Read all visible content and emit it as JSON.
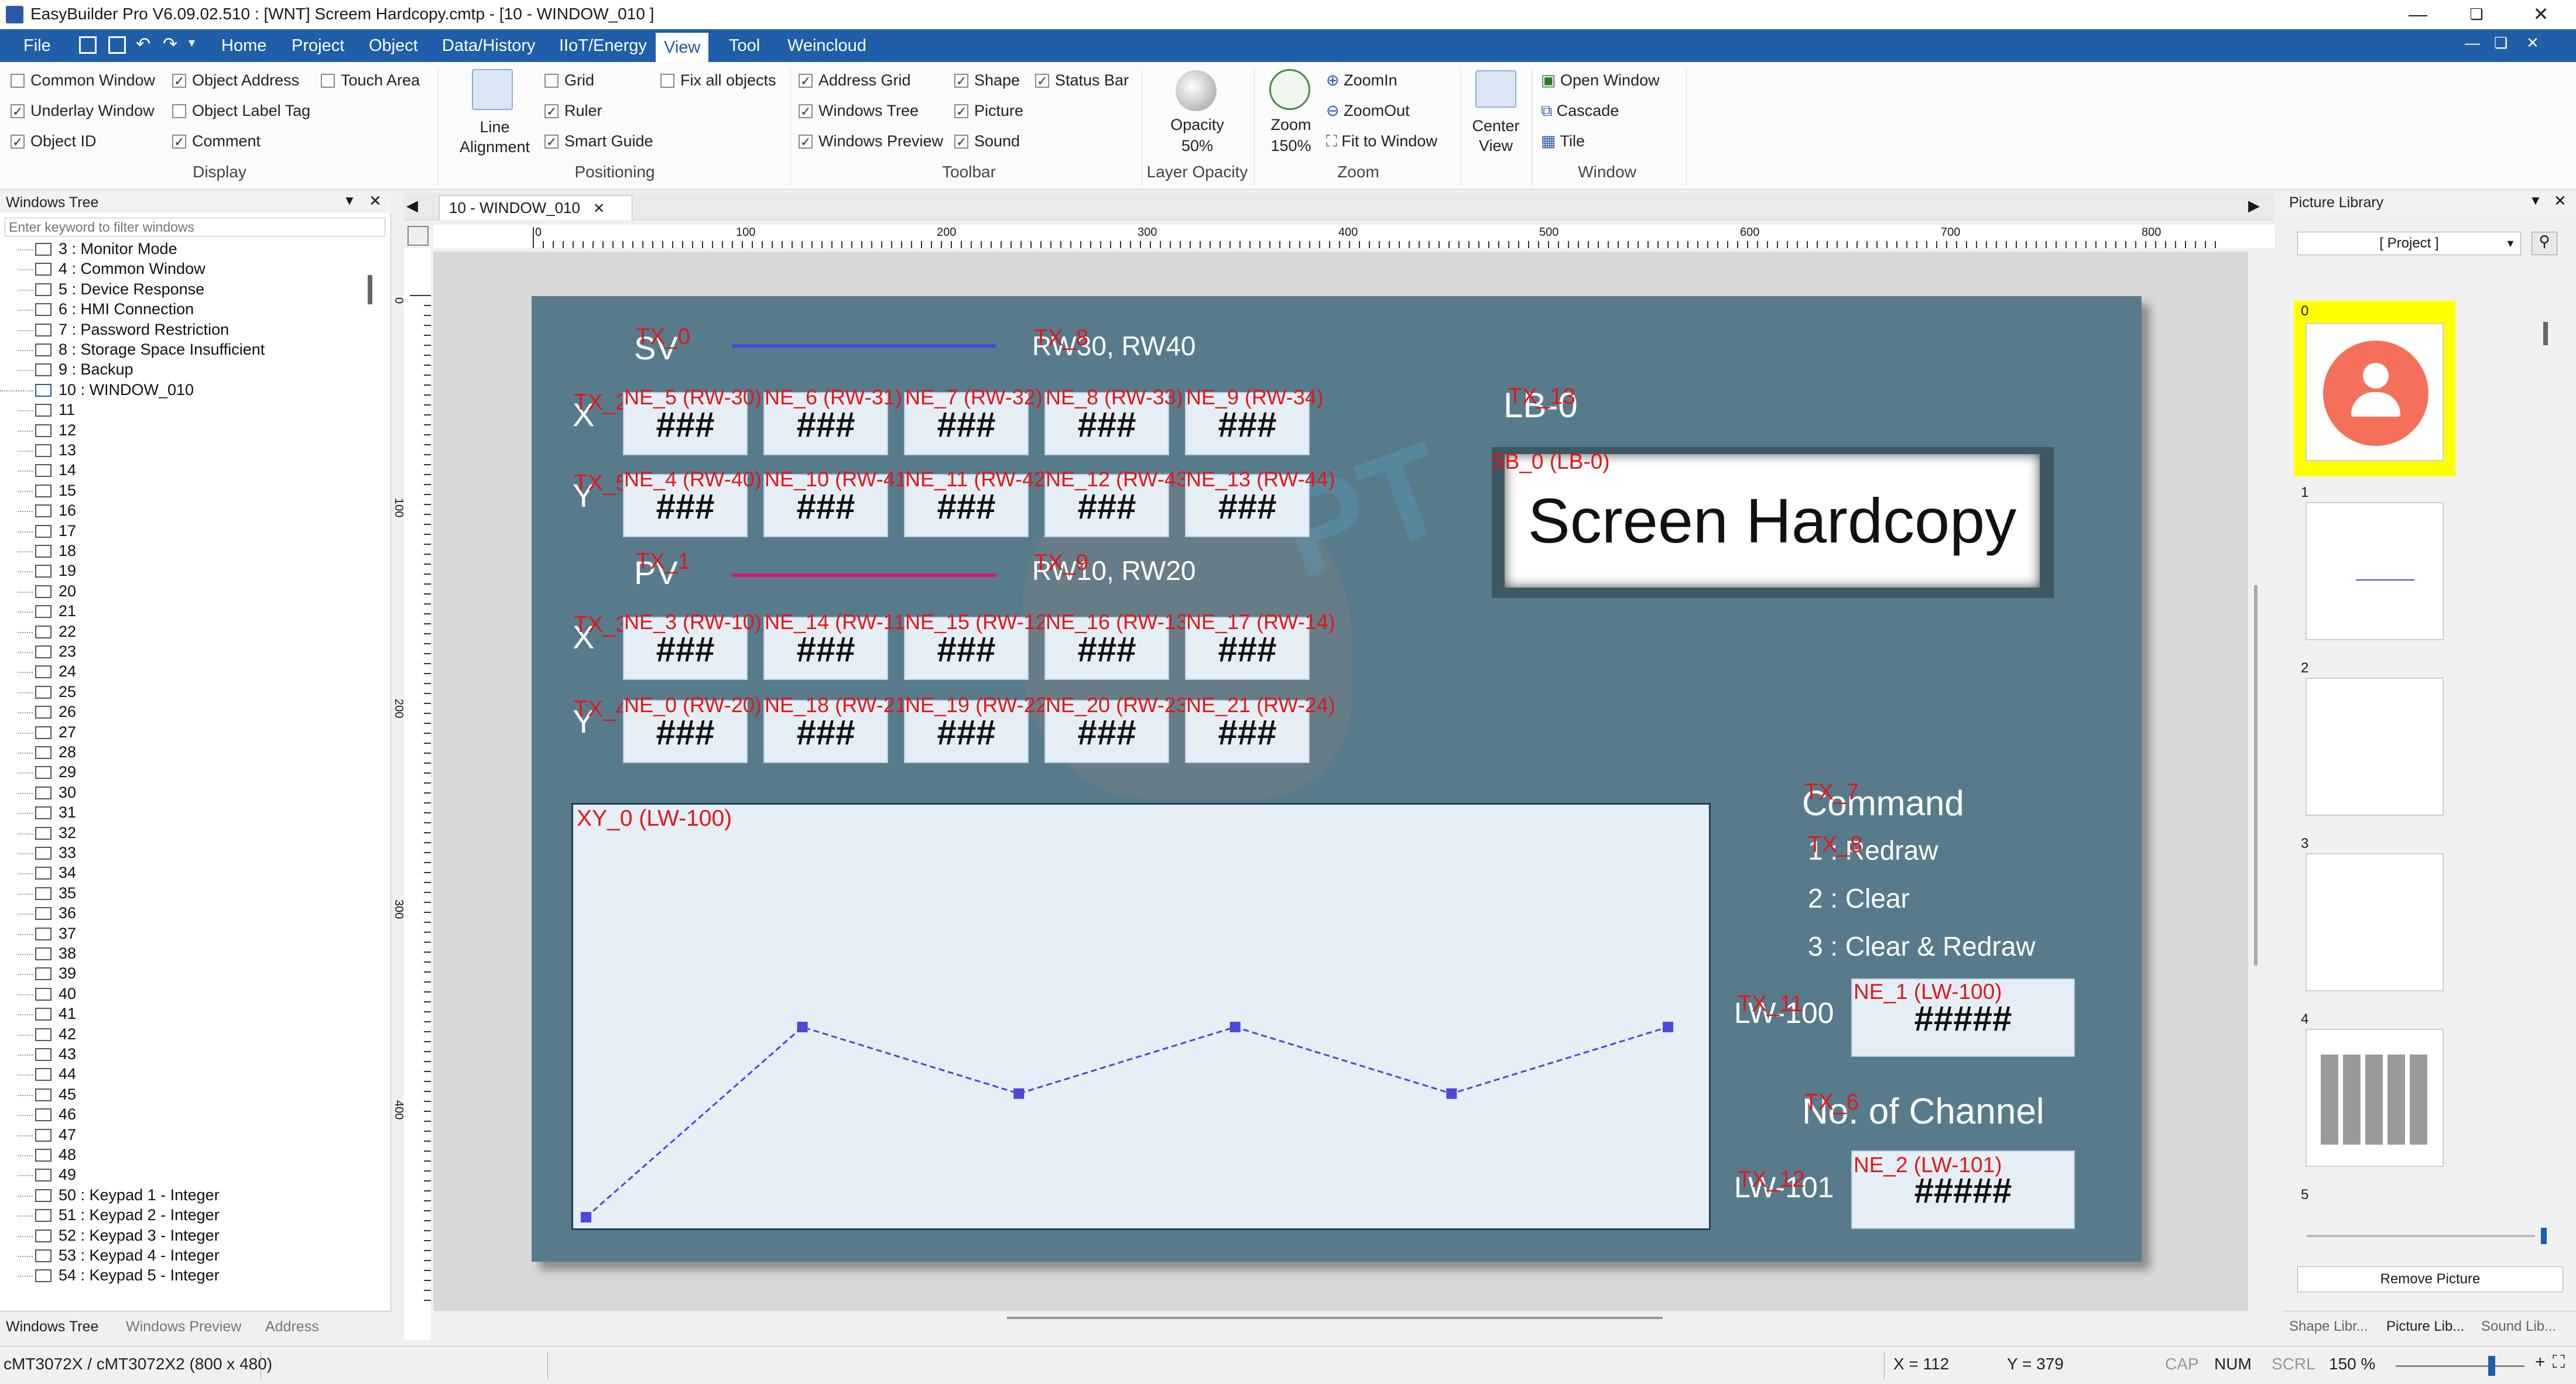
{
  "title_bar": {
    "title": "EasyBuilder Pro V6.09.02.510 : [WNT] Screem Hardcopy.cmtp - [10 - WINDOW_010 ]"
  },
  "menu": [
    "File",
    "Home",
    "Project",
    "Object",
    "Data/History",
    "IIoT/Energy",
    "View",
    "Tool",
    "Weincloud"
  ],
  "ribbon": {
    "display": {
      "label": "Display",
      "items": [
        {
          "text": "Common Window",
          "checked": false
        },
        {
          "text": "Object Address",
          "checked": true
        },
        {
          "text": "Touch Area",
          "checked": false
        },
        {
          "text": "Underlay Window",
          "checked": true
        },
        {
          "text": "Object Label Tag",
          "checked": false
        },
        {
          "text": "Object ID",
          "checked": true
        },
        {
          "text": "Comment",
          "checked": true
        }
      ]
    },
    "positioning": {
      "label": "Positioning",
      "line_alignment": "Line Alignment",
      "items": [
        {
          "text": "Grid",
          "checked": false
        },
        {
          "text": "Fix all objects",
          "checked": false
        },
        {
          "text": "Ruler",
          "checked": true
        },
        {
          "text": "Smart Guide",
          "checked": true
        }
      ]
    },
    "toolbar": {
      "label": "Toolbar",
      "items": [
        {
          "text": "Address Grid",
          "checked": true
        },
        {
          "text": "Shape",
          "checked": true
        },
        {
          "text": "Status Bar",
          "checked": true
        },
        {
          "text": "Windows Tree",
          "checked": true
        },
        {
          "text": "Picture",
          "checked": true
        },
        {
          "text": "Windows Preview",
          "checked": true
        },
        {
          "text": "Sound",
          "checked": true
        }
      ]
    },
    "layer_opacity": {
      "label": "Layer Opacity",
      "opacity": "Opacity",
      "value": "50%"
    },
    "zoom": {
      "label": "Zoom",
      "zoom_btn": "Zoom",
      "zoom_value": "150%",
      "zoom_in": "ZoomIn",
      "zoom_out": "ZoomOut",
      "fit": "Fit to Window"
    },
    "center_view": {
      "label": "Center View"
    },
    "window": {
      "label": "Window",
      "open": "Open Window",
      "cascade": "Cascade",
      "tile": "Tile"
    }
  },
  "windows_tree": {
    "title": "Windows Tree",
    "filter_placeholder": "Enter keyword to filter windows",
    "items": [
      "3 : Monitor Mode",
      "4 : Common Window",
      "5 : Device Response",
      "6 : HMI Connection",
      "7 : Password Restriction",
      "8 : Storage Space Insufficient",
      "9 : Backup",
      "10 : WINDOW_010",
      "11",
      "12",
      "13",
      "14",
      "15",
      "16",
      "17",
      "18",
      "19",
      "20",
      "21",
      "22",
      "23",
      "24",
      "25",
      "26",
      "27",
      "28",
      "29",
      "30",
      "31",
      "32",
      "33",
      "34",
      "35",
      "36",
      "37",
      "38",
      "39",
      "40",
      "41",
      "42",
      "43",
      "44",
      "45",
      "46",
      "47",
      "48",
      "49",
      "50 : Keypad 1 - Integer",
      "51 : Keypad 2 - Integer",
      "52 : Keypad 3 - Integer",
      "53 : Keypad 4 - Integer",
      "54 : Keypad 5 - Integer"
    ],
    "tabs": [
      "Windows Tree",
      "Windows Preview",
      "Address"
    ]
  },
  "editor": {
    "tab": "10 - WINDOW_010",
    "ruler": [
      "0",
      "100",
      "200",
      "300",
      "400",
      "500",
      "600",
      "700",
      "800"
    ],
    "vruler": [
      "0",
      "100",
      "200",
      "300",
      "400"
    ]
  },
  "screen": {
    "sv_label": "SV",
    "sv_addr": "RW30, RW40",
    "sv_tx": "TX_0",
    "sv_tx2": "TX_8",
    "pv_label": "PV",
    "pv_addr": "RW10, RW20",
    "pv_tx": "TX_1",
    "pv_tx2": "TX_9",
    "x_label": "X",
    "y_label": "Y",
    "row_tx": [
      "TX_2",
      "TX_5",
      "TX_3",
      "TX_4"
    ],
    "rows": [
      [
        "NE_5 (RW-30)",
        "NE_6 (RW-31)",
        "NE_7 (RW-32)",
        "NE_8 (RW-33)",
        "NE_9 (RW-34)"
      ],
      [
        "NE_4 (RW-40)",
        "NE_10 (RW-41)",
        "NE_11 (RW-42)",
        "NE_12 (RW-43)",
        "NE_13 (RW-44)"
      ],
      [
        "NE_3 (RW-10)",
        "NE_14 (RW-11)",
        "NE_15 (RW-12)",
        "NE_16 (RW-13)",
        "NE_17 (RW-14)"
      ],
      [
        "NE_0 (RW-20)",
        "NE_18 (RW-21)",
        "NE_19 (RW-22)",
        "NE_20 (RW-23)",
        "NE_21 (RW-24)"
      ]
    ],
    "hash": "###",
    "hash5": "#####",
    "lb_label": "LB-0",
    "lb_tx": "TX_13",
    "sb_tag": "SB_0 (LB-0)",
    "sb_text": "Screen Hardcopy",
    "xy_tag": "XY_0 (LW-100)",
    "chart_points": [
      [
        0,
        0
      ],
      [
        1,
        1
      ],
      [
        2,
        0.65
      ],
      [
        3,
        1
      ],
      [
        4,
        0.65
      ],
      [
        5,
        1
      ]
    ],
    "command": "Command",
    "command_tx": "TX_7",
    "cmd1": "1 : Redraw",
    "cmd1_tx": "TX_8",
    "cmd2": "2 : Clear",
    "cmd3": "3 : Clear & Redraw",
    "lw100": "LW-100",
    "lw100_tx": "TX_11",
    "ne1": "NE_1 (LW-100)",
    "channel": "No. of Channel",
    "channel_tx": "TX_6",
    "lw101": "LW-101",
    "lw101_tx": "TX_12",
    "ne2": "NE_2 (LW-101)"
  },
  "picture_library": {
    "title": "Picture Library",
    "select": "[ Project ]",
    "thumbs": [
      "0",
      "1",
      "2",
      "3",
      "4",
      "5"
    ],
    "remove": "Remove Picture",
    "tabs": [
      "Shape Libr...",
      "Picture Lib...",
      "Sound Lib..."
    ]
  },
  "status": {
    "model": "cMT3072X / cMT3072X2 (800 x 480)",
    "x": "X = 112",
    "y": "Y = 379",
    "cap": "CAP",
    "num": "NUM",
    "scrl": "SCRL",
    "zoom": "150 %"
  },
  "colors": {
    "menubar": "#1f5ea8",
    "screen_bg": "#587b8c",
    "tag_red": "#e01818",
    "sv_line": "#4a4ad8",
    "pv_line": "#d81870"
  }
}
